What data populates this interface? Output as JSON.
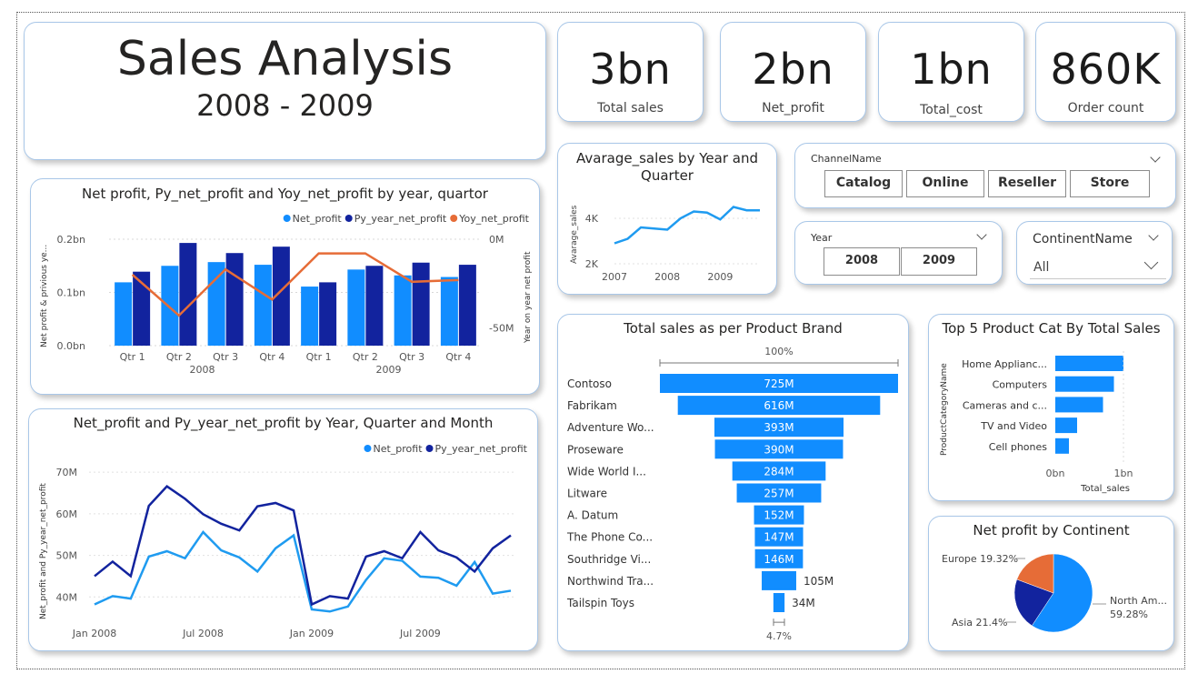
{
  "header": {
    "title": "Sales Analysis",
    "subtitle": "2008 - 2009"
  },
  "kpis": [
    {
      "value": "3bn",
      "label": "Total sales"
    },
    {
      "value": "2bn",
      "label": "Net_profit"
    },
    {
      "value": "1bn",
      "label": "Total_cost"
    },
    {
      "value": "860K",
      "label": "Order count"
    }
  ],
  "slicers": {
    "channel": {
      "title": "ChannelName",
      "options": [
        "Catalog",
        "Online",
        "Reseller",
        "Store"
      ]
    },
    "year": {
      "title": "Year",
      "options": [
        "2008",
        "2009"
      ]
    },
    "continent": {
      "title": "ContinentName",
      "value": "All"
    }
  },
  "colors": {
    "light_blue": "#118DFF",
    "dark_blue": "#12239E",
    "orange": "#E66C37",
    "mid_blue": "#1F9BF0"
  },
  "chart_data": [
    {
      "id": "quarter_combo",
      "type": "bar",
      "title": "Net profit, Py_net_profit and Yoy_net_profit by year, quartor",
      "ylabel": "Net profit & privious ye...",
      "y2label": "Year on year net profit",
      "categories": [
        "Qtr 1",
        "Qtr 2",
        "Qtr 3",
        "Qtr 4",
        "Qtr 1",
        "Qtr 2",
        "Qtr 3",
        "Qtr 4"
      ],
      "groups": [
        "2008",
        "2009"
      ],
      "yticks": [
        "0.2bn",
        "0.1bn",
        "0.0bn"
      ],
      "y2ticks": [
        "0M",
        "-50M"
      ],
      "ylim": [
        0,
        0.2
      ],
      "y2lim": [
        -60,
        0
      ],
      "series": [
        {
          "name": "Net_profit",
          "values": [
            0.119,
            0.15,
            0.157,
            0.152,
            0.111,
            0.143,
            0.132,
            0.129
          ]
        },
        {
          "name": "Py_year_net_profit",
          "values": [
            0.139,
            0.193,
            0.174,
            0.186,
            0.119,
            0.15,
            0.156,
            0.152
          ]
        },
        {
          "name": "Yoy_net_profit",
          "values": [
            -20,
            -43,
            -17,
            -34,
            -8,
            -8,
            -24,
            -23
          ]
        }
      ]
    },
    {
      "id": "avg_sales",
      "type": "line",
      "title": "Avarage_sales by Year and Quarter",
      "ylabel": "Avarage_sales",
      "xticks": [
        "2007",
        "2008",
        "2009"
      ],
      "yticks": [
        "4K",
        "2K"
      ],
      "ylim": [
        2000,
        4800
      ],
      "x": [
        2007,
        2007.25,
        2007.5,
        2007.75,
        2008,
        2008.25,
        2008.5,
        2008.75,
        2009,
        2009.25,
        2009.5,
        2009.75
      ],
      "values": [
        2900,
        3100,
        3600,
        3550,
        3500,
        4000,
        4300,
        4250,
        3950,
        4500,
        4350,
        4350
      ]
    },
    {
      "id": "brand_funnel",
      "type": "bar",
      "title": "Total sales as per Product Brand",
      "top_pct": "100%",
      "bottom_pct": "4.7%",
      "categories": [
        "Contoso",
        "Fabrikam",
        "Adventure Wo...",
        "Proseware",
        "Wide World I...",
        "Litware",
        "A. Datum",
        "The Phone Co...",
        "Southridge Vi...",
        "Northwind Tra...",
        "Tailspin Toys"
      ],
      "values": [
        725,
        616,
        393,
        390,
        284,
        257,
        152,
        147,
        146,
        105,
        34
      ],
      "labels": [
        "725M",
        "616M",
        "393M",
        "390M",
        "284M",
        "257M",
        "152M",
        "147M",
        "146M",
        "105M",
        "34M"
      ]
    },
    {
      "id": "top5_cat",
      "type": "bar",
      "title": "Top 5 Product Cat By Total Sales",
      "ylabel": "ProductCategoryName",
      "xlabel": "Total_sales",
      "xticks": [
        "0bn",
        "1bn"
      ],
      "xlim": [
        0,
        1
      ],
      "categories": [
        "Home Applianc...",
        "Computers",
        "Cameras and c...",
        "TV and Video",
        "Cell phones"
      ],
      "values": [
        1.0,
        0.86,
        0.7,
        0.32,
        0.2
      ]
    },
    {
      "id": "monthly_line",
      "type": "line",
      "title": "Net_profit and Py_year_net_profit by Year, Quarter and Month",
      "ylabel": "Net_profit and Py_year_net_profit",
      "xticks": [
        "Jan 2008",
        "Jul 2008",
        "Jan 2009",
        "Jul 2009"
      ],
      "yticks": [
        "70M",
        "60M",
        "50M",
        "40M"
      ],
      "ylim": [
        37,
        72
      ],
      "series": [
        {
          "name": "Net_profit",
          "values": [
            38.2,
            40.2,
            39.6,
            49.7,
            51.0,
            49.3,
            55.6,
            51.2,
            49.5,
            46.1,
            51.7,
            54.8,
            37.0,
            36.5,
            37.7,
            44.1,
            49.3,
            48.7,
            44.9,
            44.6,
            42.7,
            48.4,
            40.8,
            41.5
          ]
        },
        {
          "name": "Py_year_net_profit",
          "values": [
            45.0,
            48.5,
            45.0,
            61.9,
            66.6,
            63.6,
            59.9,
            57.6,
            56.0,
            61.8,
            62.6,
            60.8,
            38.2,
            40.2,
            39.6,
            49.7,
            51.0,
            49.3,
            55.6,
            51.2,
            49.5,
            46.1,
            51.7,
            54.8
          ]
        }
      ]
    },
    {
      "id": "continent_pie",
      "type": "pie",
      "title": "Net profit by Continent",
      "slices": [
        {
          "name": "North Am...",
          "value": 59.28,
          "label": "59.28%"
        },
        {
          "name": "Asia",
          "value": 21.4,
          "label": "21.4%"
        },
        {
          "name": "Europe",
          "value": 19.32,
          "label": "19.32%"
        }
      ]
    }
  ]
}
